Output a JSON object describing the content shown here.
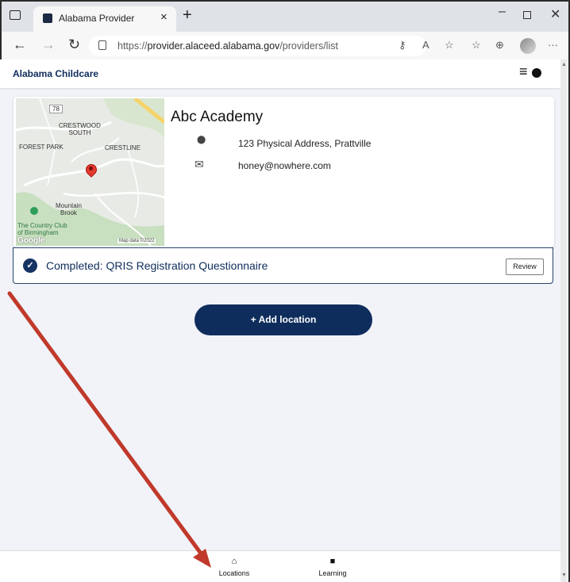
{
  "browser": {
    "tab_title": "Alabama Provider",
    "tab_close": "×",
    "new_tab": "+",
    "url_prefix": "https://",
    "url_domain": "provider.alaceed.alabama.gov",
    "url_path": "/providers/list",
    "back": "←",
    "forward": "→",
    "refresh": "↻",
    "minimize": "–",
    "close": "✕",
    "more": "···"
  },
  "app": {
    "brand": "Alabama Childcare",
    "menu_icon": "≡"
  },
  "provider": {
    "name": "Abc Academy",
    "address": "123 Physical Address, Prattville",
    "email": "honey@nowhere.com",
    "location_icon": "⬤",
    "mail_icon": "✉"
  },
  "map": {
    "labels": {
      "crestwood": "CRESTWOOD\nSOUTH",
      "forest_park": "FOREST PARK",
      "crestline": "CRESTLINE",
      "mountain_brook": "Mountain\nBrook",
      "country_club": "The Country Club\nof Birmingham",
      "road_78": "78"
    },
    "google": "Google",
    "credit": "Map data ©2022"
  },
  "status": {
    "check": "✓",
    "text": "Completed: QRIS Registration Questionnaire",
    "review_label": "Review"
  },
  "actions": {
    "add_location": "+ Add location"
  },
  "bottom_nav": {
    "locations_label": "Locations",
    "learning_label": "Learning",
    "locations_icon": "⌂",
    "learning_icon": "■"
  },
  "colors": {
    "brand_navy": "#0f2d5c",
    "annotation_arrow": "#c0392b"
  }
}
